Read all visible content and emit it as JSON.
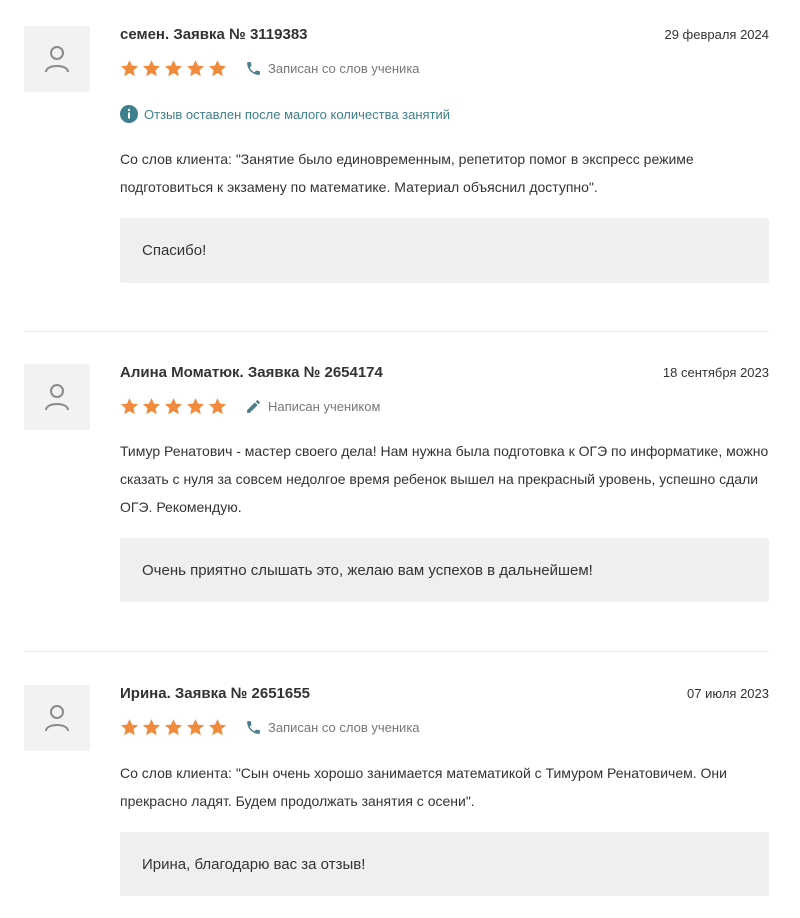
{
  "reviews": [
    {
      "author": "семен. Заявка № 3119383",
      "date": "29 февраля 2024",
      "rating": 5,
      "source": "Записан со слов ученика",
      "source_icon": "phone-icon",
      "notice": "Отзыв оставлен после малого количества занятий",
      "text": "Со слов клиента: \"Занятие было единовременным, репетитор помог в экспресс режиме подготовиться к экзамену по математике. Материал объяснил доступно\".",
      "reply": "Спасибо!"
    },
    {
      "author": "Алина Моматюк. Заявка № 2654174",
      "date": "18 сентября 2023",
      "rating": 5,
      "source": "Написан учеником",
      "source_icon": "pencil-icon",
      "text": "Тимур Ренатович - мастер своего дела! Нам нужна была подготовка к ОГЭ по информатике, можно сказать с нуля за совсем недолгое время ребенок вышел на прекрасный уровень, успешно сдали ОГЭ. Рекомендую.",
      "reply": "Очень приятно слышать это, желаю вам успехов в дальнейшем!"
    },
    {
      "author": "Ирина. Заявка № 2651655",
      "date": "07 июля 2023",
      "rating": 5,
      "source": "Записан со слов ученика",
      "source_icon": "phone-icon",
      "text": "Со слов клиента: \"Сын очень хорошо занимается математикой с Тимуром Ренатовичем. Они прекрасно ладят. Будем продолжать занятия с осени\".",
      "reply": "Ирина, благодарю вас за отзыв!"
    }
  ],
  "colors": {
    "star": "#f08a3c",
    "icon": "#4a7f8a",
    "notice": "#3d7f8c",
    "avatar_bg": "#f2f2f2",
    "reply_bg": "#efefef"
  }
}
